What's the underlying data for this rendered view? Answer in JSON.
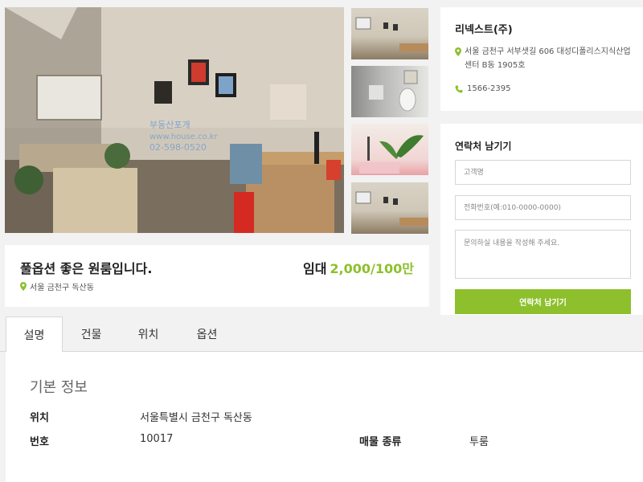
{
  "gallery": {
    "watermark_line1": "부동산포개",
    "watermark_line2": "www.house.co.kr",
    "watermark_line3": "02-598-0520"
  },
  "summary": {
    "title": "풀옵션 좋은 원룸입니다.",
    "location": "서울 금천구 독산동",
    "price_type": "임대",
    "price": "2,000/100만"
  },
  "agency": {
    "name": "리넥스트(주)",
    "address": "서울 금천구 서부샛길 606 대성디폴리스지식산업센터 B동 1905호",
    "phone": "1566-2395"
  },
  "contact": {
    "heading": "연락처 남기기",
    "name_placeholder": "고객명",
    "phone_placeholder": "전화번호(예:010-0000-0000)",
    "message_placeholder": "문의하실 내용을 작성해 주세요.",
    "submit_label": "연락처 남기기"
  },
  "tabs": [
    {
      "label": "설명",
      "active": true
    },
    {
      "label": "건물",
      "active": false
    },
    {
      "label": "위치",
      "active": false
    },
    {
      "label": "옵션",
      "active": false
    }
  ],
  "info": {
    "heading": "기본 정보",
    "location_label": "위치",
    "location_value": "서울특별시 금천구 독산동",
    "number_label": "번호",
    "number_value": "10017",
    "type_label": "매물 종류",
    "type_value": "투룸"
  },
  "colors": {
    "accent": "#8dc02c",
    "background": "#f2f2f2",
    "panel": "#ffffff"
  }
}
